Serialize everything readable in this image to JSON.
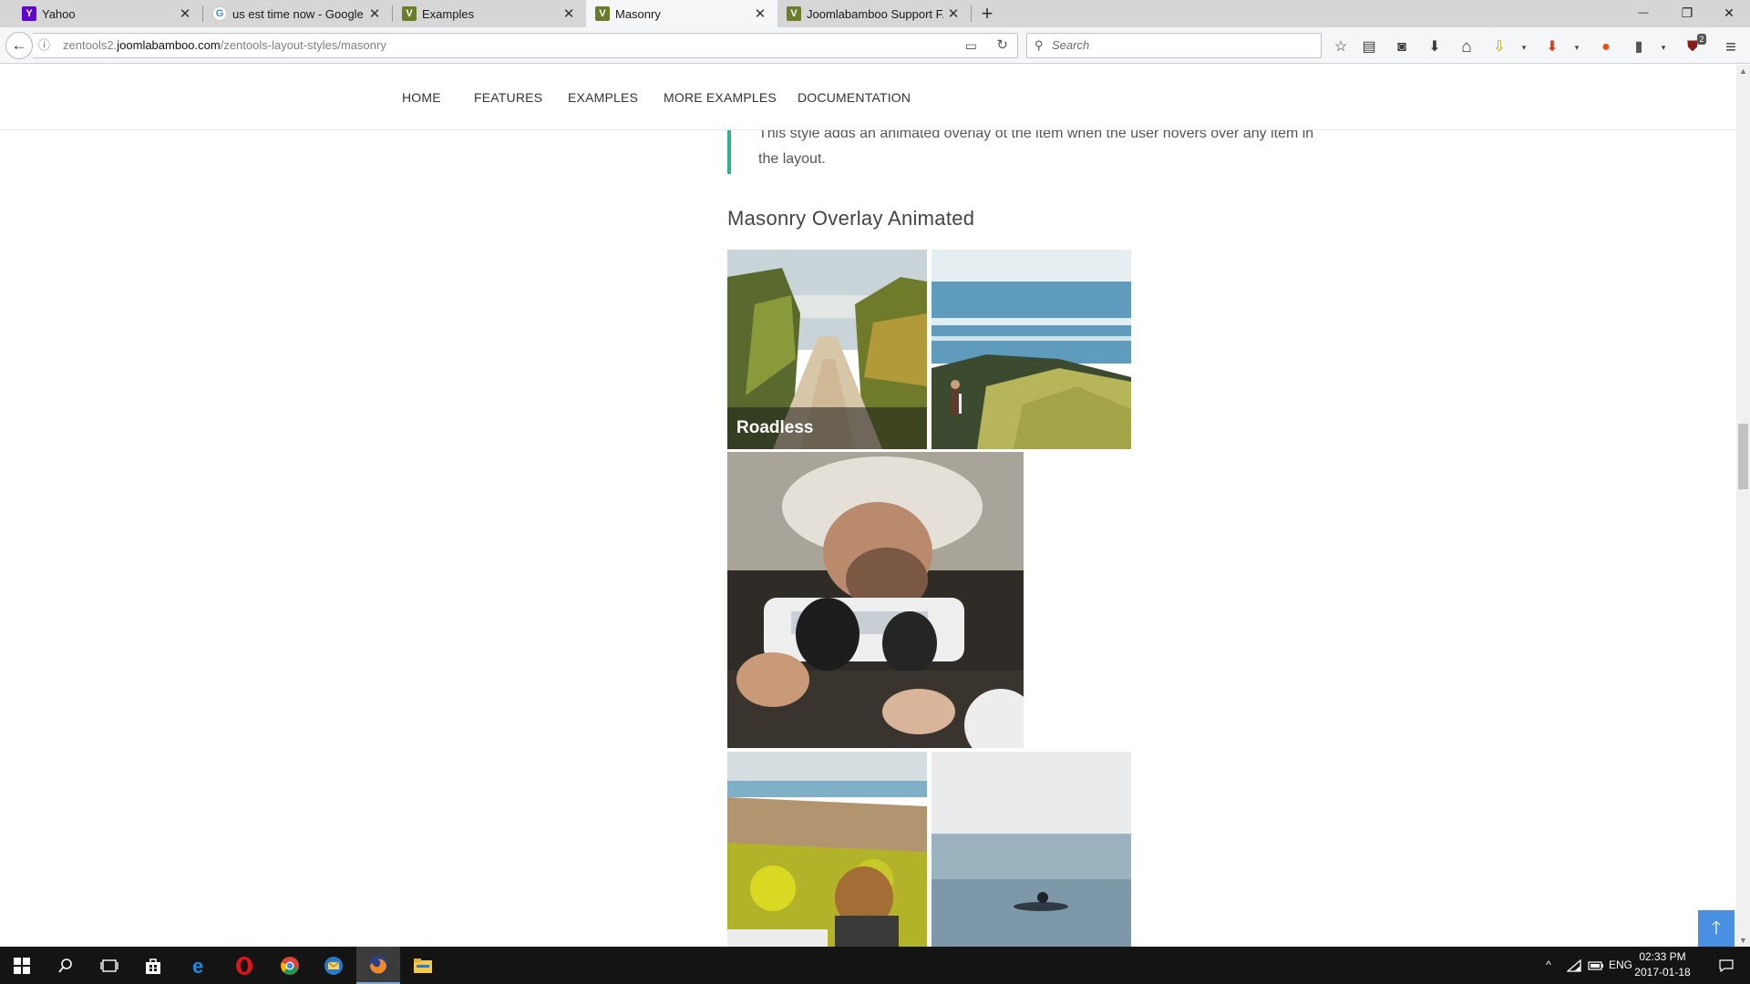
{
  "browser": {
    "tabs": [
      {
        "title": "Yahoo",
        "favicon": "yahoo-icon",
        "favicon_text": "Y",
        "favicon_color": "#5f01d1",
        "active": false
      },
      {
        "title": "us est time now - Google ...",
        "favicon": "google-icon",
        "favicon_text": "G",
        "favicon_color": "#4285f4",
        "active": false
      },
      {
        "title": "Examples",
        "favicon": "joomlabamboo-icon",
        "favicon_text": "V",
        "favicon_color": "#6b7d2a",
        "active": false
      },
      {
        "title": "Masonry",
        "favicon": "joomlabamboo-icon",
        "favicon_text": "V",
        "favicon_color": "#6b7d2a",
        "active": true
      },
      {
        "title": "Joomlabamboo Support F...",
        "favicon": "joomlabamboo-icon",
        "favicon_text": "V",
        "favicon_color": "#6b7d2a",
        "active": false
      }
    ],
    "tab_close_glyph": "✕",
    "new_tab_glyph": "+",
    "window_controls": {
      "minimize": "—",
      "restore": "❐",
      "close": "✕"
    },
    "back_glyph": "←",
    "url": {
      "prefix": "zentools2.",
      "domain": "joomlabamboo.com",
      "path": "/zentools-layout-styles/masonry"
    },
    "url_info_glyph": "ⓘ",
    "reader_glyph": "▭",
    "reload_glyph": "↻",
    "search_glyph": "⚲",
    "search_placeholder": "Search",
    "toolbar_icons": [
      {
        "name": "bookmark-star-icon",
        "glyph": "☆"
      },
      {
        "name": "bookmarks-library-icon",
        "glyph": "▤"
      },
      {
        "name": "pocket-icon",
        "glyph": "◙"
      },
      {
        "name": "downloads-icon",
        "glyph": "⬇"
      },
      {
        "name": "home-icon",
        "glyph": "⌂"
      },
      {
        "name": "download-helper-icon",
        "glyph": "⇩"
      },
      {
        "name": "extension-dropdown-icon",
        "glyph": "▾"
      },
      {
        "name": "extension-arrow-icon",
        "glyph": "⬇"
      },
      {
        "name": "extension-dropdown-icon-2",
        "glyph": "▾"
      },
      {
        "name": "colorful-extension-icon",
        "glyph": "●"
      },
      {
        "name": "clipboard-icon",
        "glyph": "▮"
      },
      {
        "name": "extension-dropdown-icon-3",
        "glyph": "▾"
      },
      {
        "name": "ublock-icon",
        "glyph": "⛊"
      },
      {
        "name": "hamburger-menu-icon",
        "glyph": "≡"
      }
    ],
    "ublock_badge": "2"
  },
  "site": {
    "nav": [
      "HOME",
      "FEATURES",
      "EXAMPLES",
      "MORE EXAMPLES",
      "DOCUMENTATION"
    ],
    "quote_text": "This style adds an animated overlay ot the item when the user hovers over any item in the layout.",
    "section_title": "Masonry Overlay Animated",
    "items": [
      {
        "caption": "Roadless",
        "photo": "sandy-road-through-bushes"
      },
      {
        "caption": "",
        "photo": "surfer-walking-down-coastal-path"
      },
      {
        "caption": "",
        "photo": "bearded-man-in-cap-at-cafe"
      },
      {
        "caption": "",
        "photo": "curly-haired-surfer-on-cliff"
      },
      {
        "caption": "",
        "photo": "surfer-paddling-in-ocean"
      }
    ],
    "back_to_top_glyph": "🡑"
  },
  "scrollbar": {
    "up_glyph": "▲",
    "down_glyph": "▼"
  },
  "taskbar": {
    "apps": [
      {
        "name": "start-button-icon"
      },
      {
        "name": "cortana-search-icon"
      },
      {
        "name": "task-view-icon"
      },
      {
        "name": "store-icon"
      },
      {
        "name": "edge-icon"
      },
      {
        "name": "opera-icon"
      },
      {
        "name": "chrome-icon"
      },
      {
        "name": "thunderbird-icon"
      },
      {
        "name": "firefox-icon"
      },
      {
        "name": "file-explorer-icon"
      }
    ],
    "tray_chevron": "^",
    "language": "ENG",
    "time": "02:33 PM",
    "date": "2017-01-18"
  }
}
